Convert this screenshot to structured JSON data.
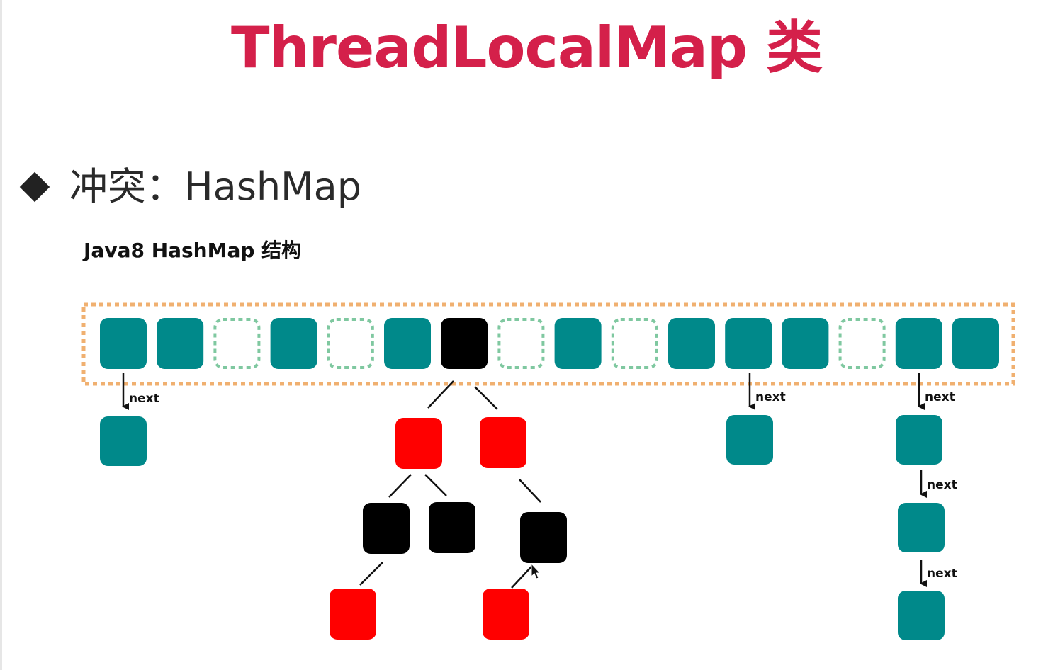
{
  "slide": {
    "title": "ThreadLocalMap 类",
    "bullet_text": "冲突：HashMap",
    "subtitle": "Java8 HashMap 结构"
  },
  "colors": {
    "title": "#d4204a",
    "teal": "#00898a",
    "black": "#000000",
    "red": "#ff0000",
    "empty_dash": "#7fc8a0",
    "table_dash": "#f0b070"
  },
  "diagram": {
    "bucket_array": [
      "filled",
      "filled",
      "empty",
      "filled",
      "empty",
      "filled",
      "tree-root",
      "empty",
      "filled",
      "empty",
      "filled",
      "filled",
      "filled",
      "empty",
      "filled",
      "filled"
    ],
    "next_label": "next",
    "linked_chains": [
      {
        "bucket_index": 0,
        "length": 1
      },
      {
        "bucket_index": 11,
        "length": 1
      },
      {
        "bucket_index": 14,
        "length": 3
      }
    ],
    "red_black_tree": {
      "bucket_index": 6,
      "levels": [
        [
          "red",
          "red"
        ],
        [
          "black",
          "black",
          "black"
        ],
        [
          "red",
          "red"
        ]
      ]
    }
  }
}
